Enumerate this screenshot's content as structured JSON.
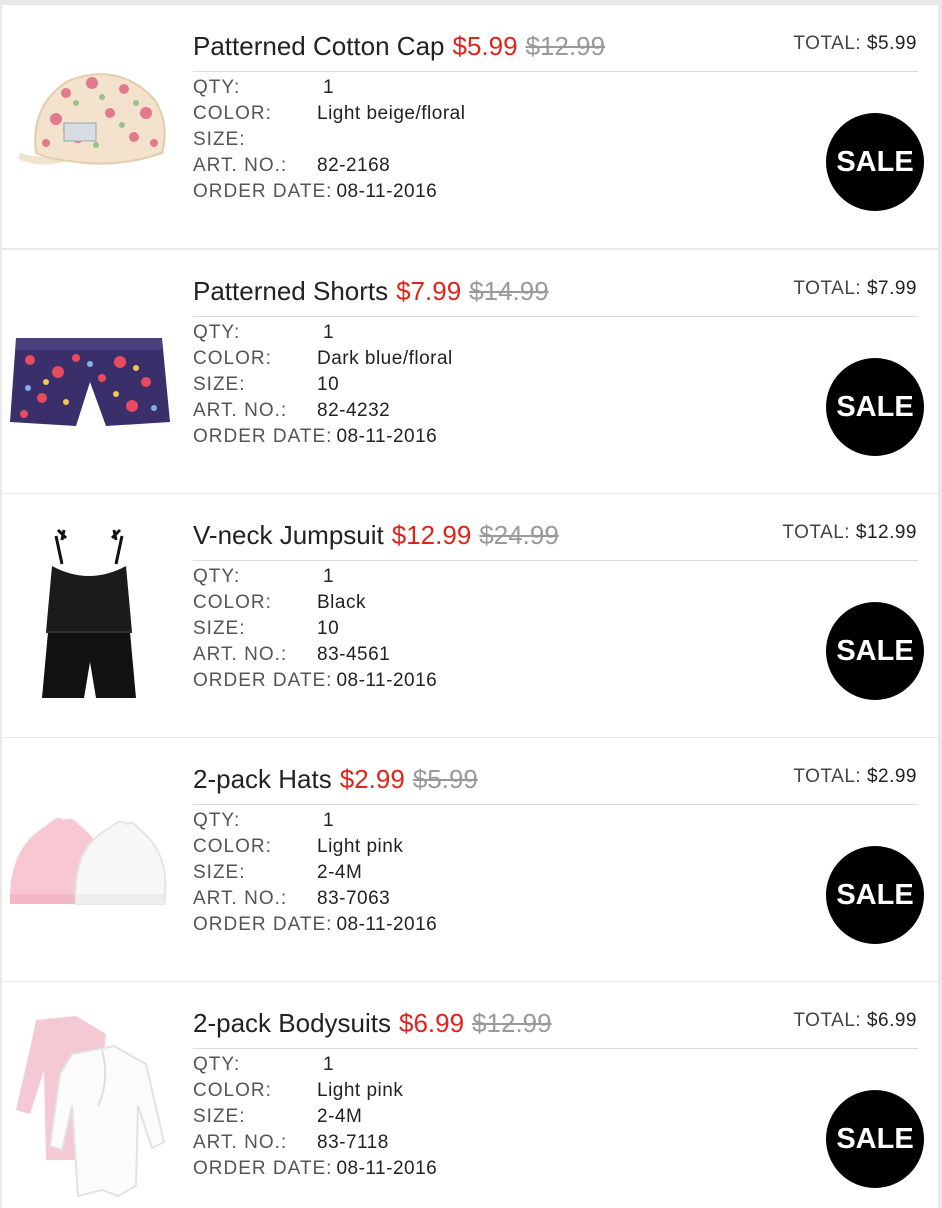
{
  "labels": {
    "total": "TOTAL:",
    "qty": "QTY:",
    "color": "COLOR:",
    "size": "SIZE:",
    "art_no": "ART. NO.:",
    "order_date": "ORDER DATE:",
    "sale_badge": "SALE"
  },
  "colors": {
    "sale_price": "#e2231a",
    "original_price": "#9a9a9a",
    "badge": "#000000"
  },
  "items": [
    {
      "name": "Patterned Cotton Cap",
      "sale_price": "$5.99",
      "original_price": "$12.99",
      "total": "$5.99",
      "qty": "1",
      "color": "Light beige/floral",
      "size": "",
      "art_no": "82-2168",
      "order_date": "08-11-2016",
      "image_icon": "floral-cap-icon"
    },
    {
      "name": "Patterned Shorts",
      "sale_price": "$7.99",
      "original_price": "$14.99",
      "total": "$7.99",
      "qty": "1",
      "color": "Dark blue/floral",
      "size": "10",
      "art_no": "82-4232",
      "order_date": "08-11-2016",
      "image_icon": "floral-shorts-icon"
    },
    {
      "name": "V-neck Jumpsuit",
      "sale_price": "$12.99",
      "original_price": "$24.99",
      "total": "$12.99",
      "qty": "1",
      "color": "Black",
      "size": "10",
      "art_no": "83-4561",
      "order_date": "08-11-2016",
      "image_icon": "jumpsuit-icon"
    },
    {
      "name": "2-pack Hats",
      "sale_price": "$2.99",
      "original_price": "$5.99",
      "total": "$2.99",
      "qty": "1",
      "color": "Light pink",
      "size": "2-4M",
      "art_no": "83-7063",
      "order_date": "08-11-2016",
      "image_icon": "baby-hats-icon"
    },
    {
      "name": "2-pack Bodysuits",
      "sale_price": "$6.99",
      "original_price": "$12.99",
      "total": "$6.99",
      "qty": "1",
      "color": "Light pink",
      "size": "2-4M",
      "art_no": "83-7118",
      "order_date": "08-11-2016",
      "image_icon": "bodysuits-icon"
    }
  ]
}
